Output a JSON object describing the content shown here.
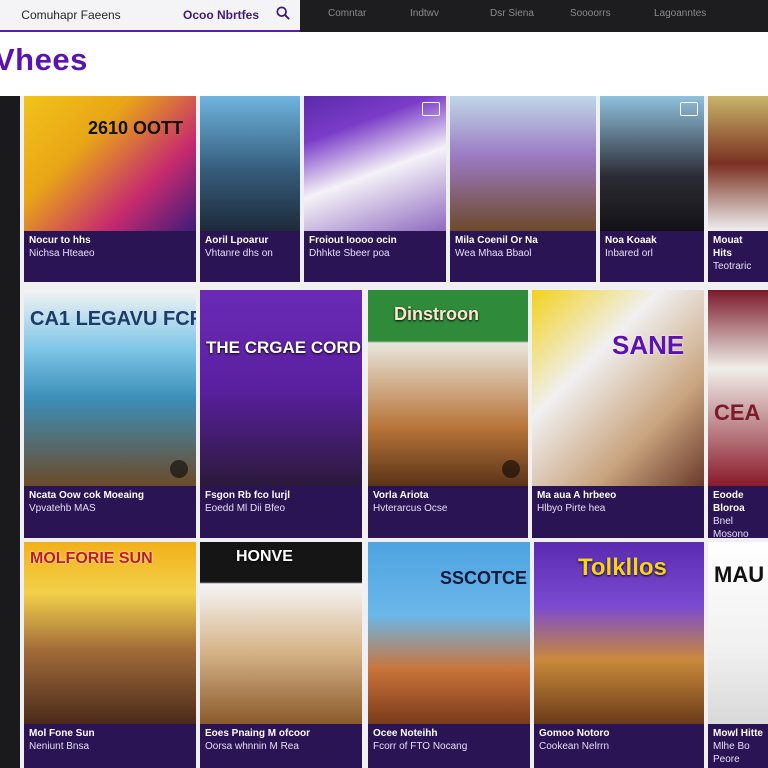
{
  "tabs": [
    {
      "label": "Comuhapr Faeens"
    },
    {
      "label": "Ocoo Nbrtfes"
    }
  ],
  "nav": [
    "Comntar",
    "Indtwv",
    "Dsr Siena",
    "Soooorrs",
    "Lagoanntes"
  ],
  "brand": "Vhees",
  "colors": {
    "accent": "#5a12b0",
    "caption": "#2a1454",
    "page": "#f0f0f2"
  },
  "cards": [
    {
      "caption1": "Nocur to hhs",
      "caption2": "Nichsa Hteaeo",
      "label": "2610 OOTT"
    },
    {
      "caption1": "Aoril Lpoarur",
      "caption2": "Vhtanre dhs on",
      "label": ""
    },
    {
      "caption1": "Froiout Ioooo ocin",
      "caption2": "Dhhkte Sbeer poa",
      "label": ""
    },
    {
      "caption1": "Mila Coenil Or Na",
      "caption2": "Wea Mhaa Bbaol",
      "label": ""
    },
    {
      "caption1": "Noa Koaak",
      "caption2": "Inbared orl",
      "label": ""
    },
    {
      "caption1": "Mouat Hits",
      "caption2": "Teotraric",
      "label": ""
    },
    {
      "caption1": "Ncata Oow cok Moeaing",
      "caption2": "Vpvatehb MAS",
      "label": "CA1 LEGAVU FCR"
    },
    {
      "caption1": "Fsgon Rb fco lurjl",
      "caption2": "Eoedd Ml Dii Bfeo",
      "label": "THE CRGAE CORD"
    },
    {
      "caption1": "Vorla Ariota",
      "caption2": "Hvterarcus Ocse",
      "label": "Dinstroon"
    },
    {
      "caption1": "Ma aua A hrbeeo",
      "caption2": "Hlbyo Pirte hea",
      "label": "SANE"
    },
    {
      "caption1": "Eoode Bloroa",
      "caption2": "Bnel Mosono",
      "label": "CEA"
    },
    {
      "caption1": "Mol Fone Sun",
      "caption2": "Neniunt Bnsa",
      "label": "MOLFORIE SUN"
    },
    {
      "caption1": "Eoes Pnaing M ofcoor",
      "caption2": "Oorsa whnnin M Rea",
      "label": "HONVE"
    },
    {
      "caption1": "Ocee Noteihh",
      "caption2": "Fcorr of FTO Nocang",
      "label": "SSCOTCE"
    },
    {
      "caption1": "Gomoo Notoro",
      "caption2": "Cookean Nelrrn",
      "label": "Tolkllos"
    },
    {
      "caption1": "Mowl Hitte",
      "caption2": "Mlhe Bo Peore",
      "label": "MAU"
    }
  ]
}
